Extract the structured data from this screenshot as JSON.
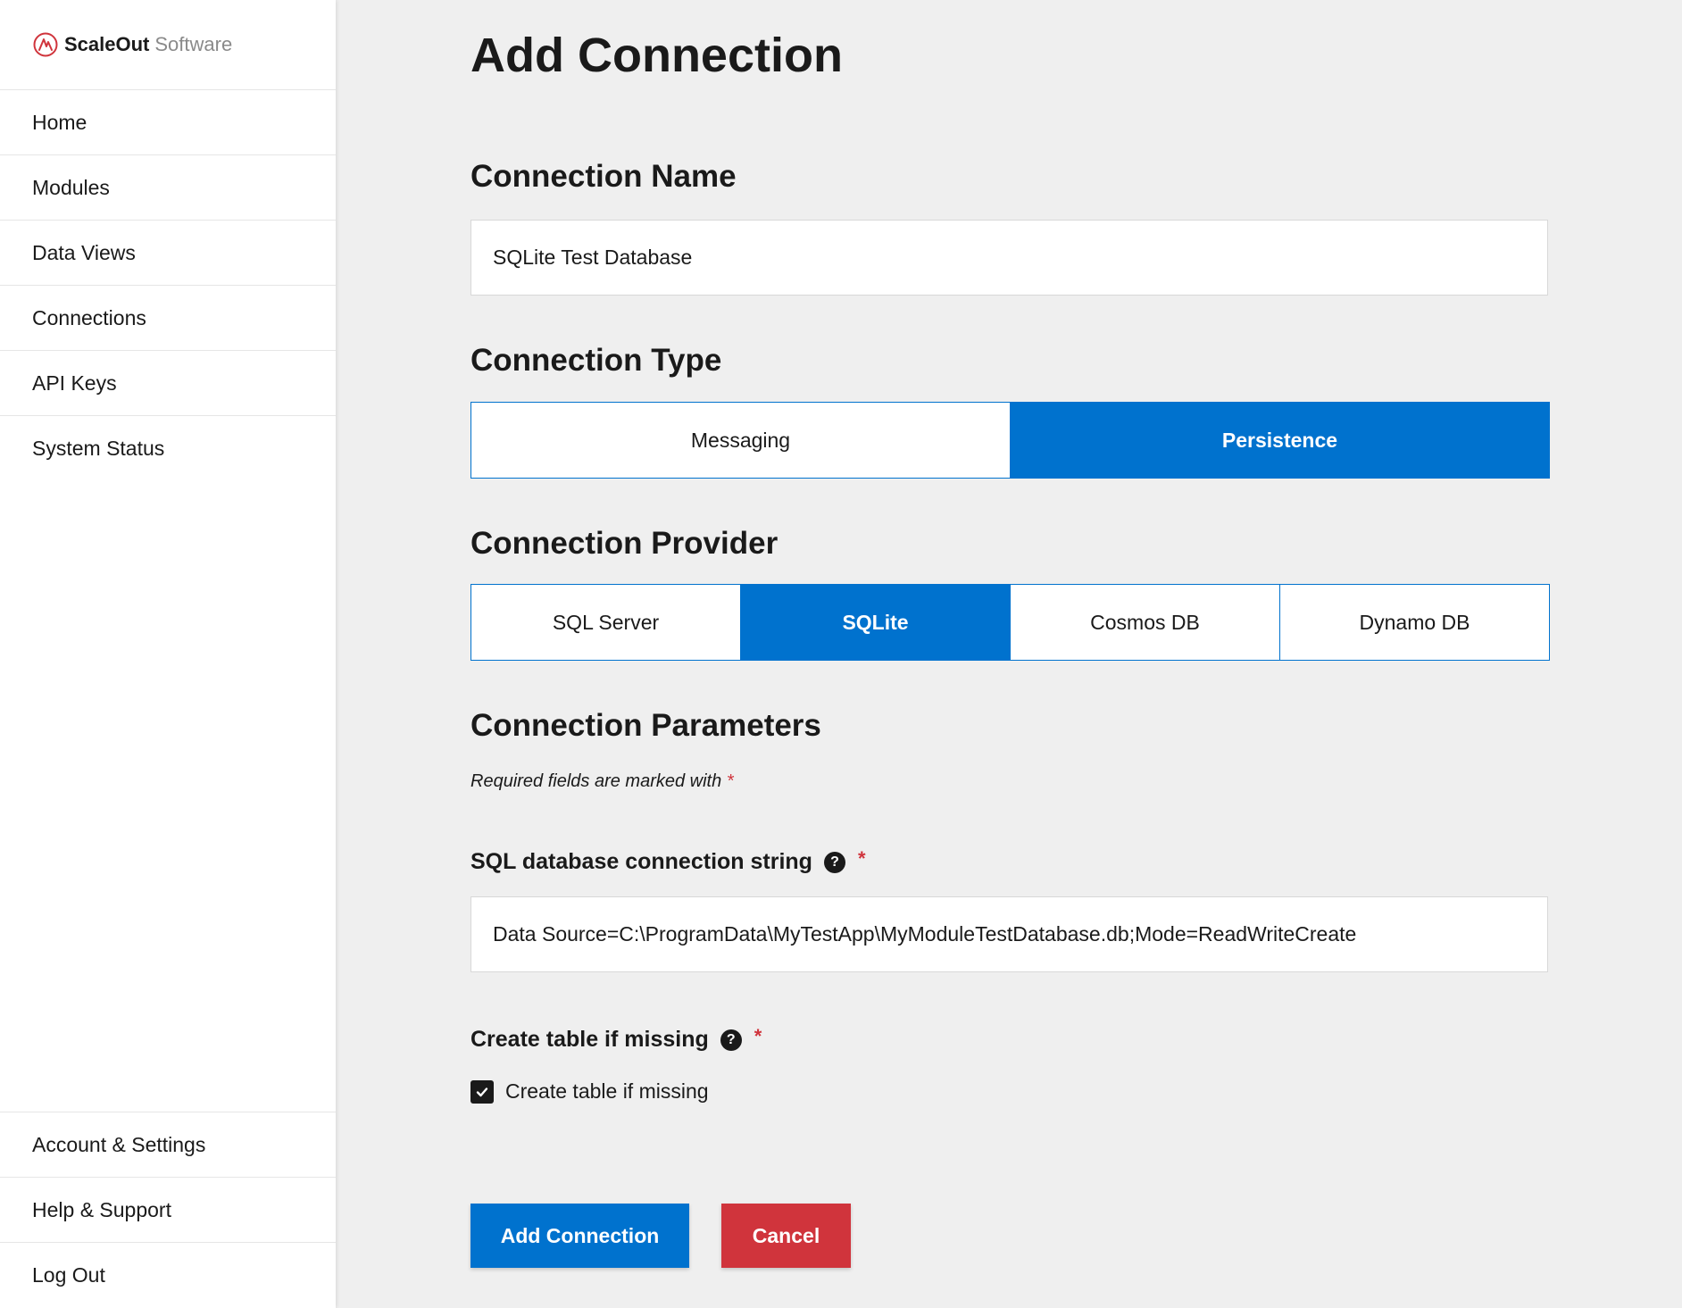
{
  "sidebar": {
    "brand": {
      "name": "ScaleOut",
      "sub": "Software"
    },
    "nav": [
      {
        "label": "Home"
      },
      {
        "label": "Modules"
      },
      {
        "label": "Data Views"
      },
      {
        "label": "Connections"
      },
      {
        "label": "API Keys"
      },
      {
        "label": "System Status"
      }
    ],
    "bottom_nav": [
      {
        "label": "Account & Settings"
      },
      {
        "label": "Help & Support"
      },
      {
        "label": "Log Out"
      }
    ]
  },
  "main": {
    "title": "Add Connection",
    "connection_name": {
      "heading": "Connection Name",
      "value": "SQLite Test Database"
    },
    "connection_type": {
      "heading": "Connection Type",
      "options": [
        "Messaging",
        "Persistence"
      ],
      "selected": "Persistence"
    },
    "connection_provider": {
      "heading": "Connection Provider",
      "options": [
        "SQL Server",
        "SQLite",
        "Cosmos DB",
        "Dynamo DB"
      ],
      "selected": "SQLite"
    },
    "parameters": {
      "heading": "Connection Parameters",
      "required_note": "Required fields are marked with",
      "required_star": "*",
      "conn_string": {
        "label": "SQL database connection string",
        "help": "?",
        "star": "*",
        "value": "Data Source=C:\\ProgramData\\MyTestApp\\MyModuleTestDatabase.db;Mode=ReadWriteCreate"
      },
      "create_table": {
        "label": "Create table if missing",
        "help": "?",
        "star": "*",
        "checkbox_label": "Create table if missing",
        "checked": true
      }
    },
    "buttons": {
      "add": "Add Connection",
      "cancel": "Cancel"
    }
  },
  "colors": {
    "accent": "#0072ce",
    "danger": "#d0343c",
    "logo": "#d0343c",
    "background": "#efefef"
  }
}
